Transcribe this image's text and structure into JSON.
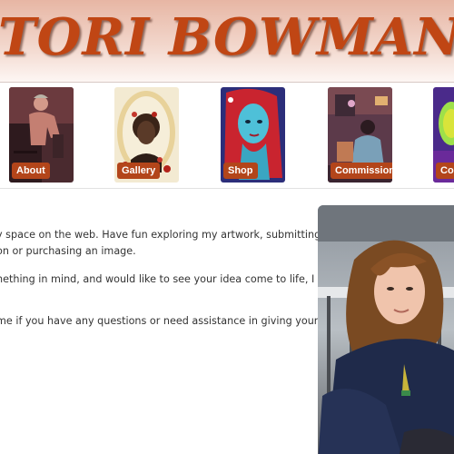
{
  "header": {
    "title": "TORI BOWMAN"
  },
  "nav": {
    "items": [
      {
        "label": "About",
        "icon": "self-portrait-icon"
      },
      {
        "label": "Gallery",
        "icon": "portrait-medallion-icon"
      },
      {
        "label": "Shop",
        "icon": "blue-face-icon"
      },
      {
        "label": "Commission",
        "icon": "figure-scene-icon"
      },
      {
        "label": "Co",
        "icon": "green-face-icon"
      }
    ]
  },
  "main": {
    "intro_lines": [
      "y space on the web. Have fun exploring my artwork, submitting",
      "on or purchasing an image.",
      "nething in mind, and would like to see your idea come to life, I",
      "me if you have any questions or need assistance in giving your"
    ]
  },
  "colors": {
    "title": "#c04614",
    "nav_label_bg": "#b3451a",
    "header_gradient_top": "#e7b6a4"
  }
}
